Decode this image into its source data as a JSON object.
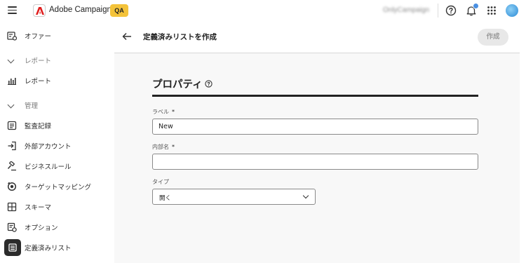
{
  "topbar": {
    "app_name": "Adobe Campaign",
    "env_badge": "QA",
    "org_name": "OnlyCampaign",
    "icons": [
      "menu-icon",
      "adobe-logo-icon",
      "help-icon",
      "bell-icon",
      "apps-grid-icon",
      "avatar"
    ]
  },
  "sidebar": {
    "items": [
      {
        "label": "オファー",
        "icon": "offer-icon"
      },
      {
        "label": "レポート",
        "icon": "chevron-down-icon",
        "section": true
      },
      {
        "label": "レポート",
        "icon": "bar-chart-icon"
      },
      {
        "label": "管理",
        "icon": "chevron-down-icon",
        "section": true
      },
      {
        "label": "監査記録",
        "icon": "audit-icon"
      },
      {
        "label": "外部アカウント",
        "icon": "login-icon"
      },
      {
        "label": "ビジネスルール",
        "icon": "gavel-icon"
      },
      {
        "label": "ターゲットマッピング",
        "icon": "target-mapping-icon"
      },
      {
        "label": "スキーマ",
        "icon": "schema-icon"
      },
      {
        "label": "オプション",
        "icon": "options-icon"
      },
      {
        "label": "定義済みリスト",
        "icon": "list-icon",
        "active": true
      }
    ]
  },
  "header": {
    "title": "定義済みリストを作成",
    "create_label": "作成"
  },
  "form": {
    "section_title": "プロパティ",
    "label_field": {
      "label": "ラベル",
      "required_mark": "*",
      "value": "New"
    },
    "internal_name_field": {
      "label": "内部名",
      "required_mark": "*",
      "value": ""
    },
    "type_field": {
      "label": "タイプ",
      "value": "開く"
    }
  },
  "colors": {
    "badge": "#f4c33a",
    "notification": "#4a90e2",
    "active_nav": "#2b2b2b"
  }
}
